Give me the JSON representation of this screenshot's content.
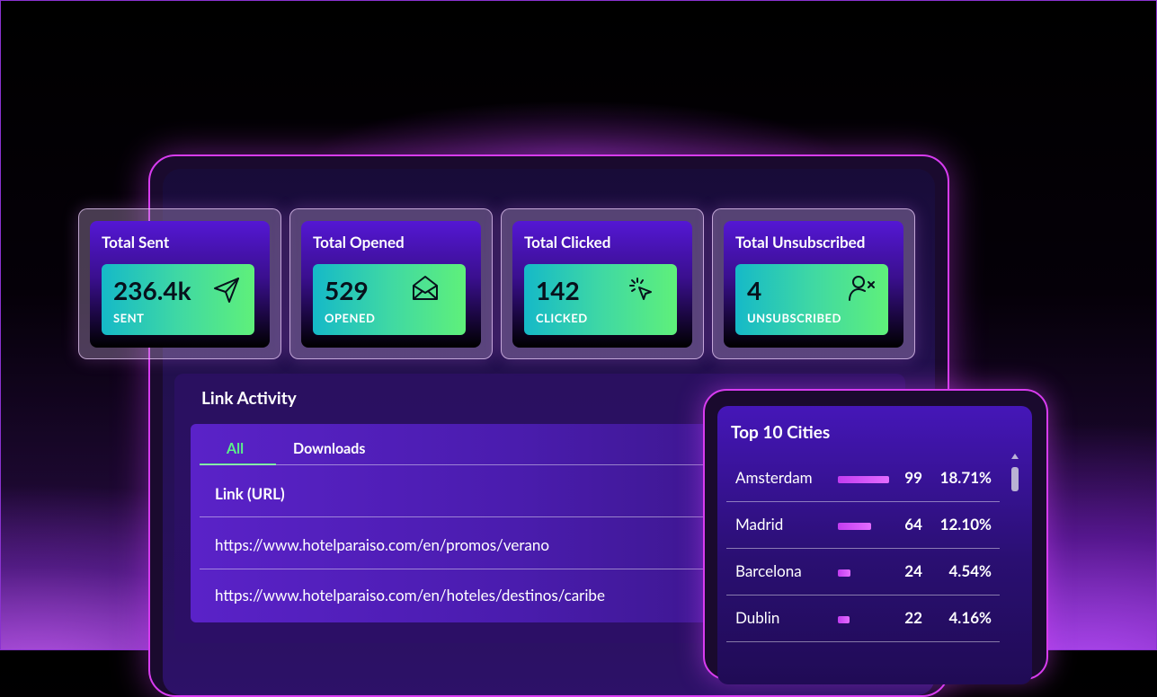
{
  "stats": [
    {
      "title": "Total Sent",
      "value": "236.4k",
      "label": "SENT",
      "icon": "paper-plane-icon"
    },
    {
      "title": "Total Opened",
      "value": "529",
      "label": "OPENED",
      "icon": "open-envelope-icon"
    },
    {
      "title": "Total Clicked",
      "value": "142",
      "label": "CLICKED",
      "icon": "cursor-click-icon"
    },
    {
      "title": "Total Unsubscribed",
      "value": "4",
      "label": "UNSUBSCRIBED",
      "icon": "user-remove-icon"
    }
  ],
  "link_activity": {
    "title": "Link Activity",
    "tabs": [
      "All",
      "Downloads"
    ],
    "active_tab": "All",
    "column_header": "Link (URL)",
    "rows": [
      "https://www.hotelparaiso.com/en/promos/verano",
      "https://www.hotelparaiso.com/en/hoteles/destinos/caribe"
    ]
  },
  "top_cities": {
    "title": "Top 10 Cities",
    "rows": [
      {
        "city": "Amsterdam",
        "count": "99",
        "percent": "18.71%",
        "bar_fraction": 0.1871
      },
      {
        "city": "Madrid",
        "count": "64",
        "percent": "12.10%",
        "bar_fraction": 0.121
      },
      {
        "city": "Barcelona",
        "count": "24",
        "percent": "4.54%",
        "bar_fraction": 0.0454
      },
      {
        "city": "Dublin",
        "count": "22",
        "percent": "4.16%",
        "bar_fraction": 0.0416
      }
    ]
  },
  "colors": {
    "accent_green": "#5cf08a",
    "accent_magenta": "#d83cf0",
    "tile_gradient_start": "#15b9c8",
    "tile_gradient_end": "#5ff07a"
  }
}
